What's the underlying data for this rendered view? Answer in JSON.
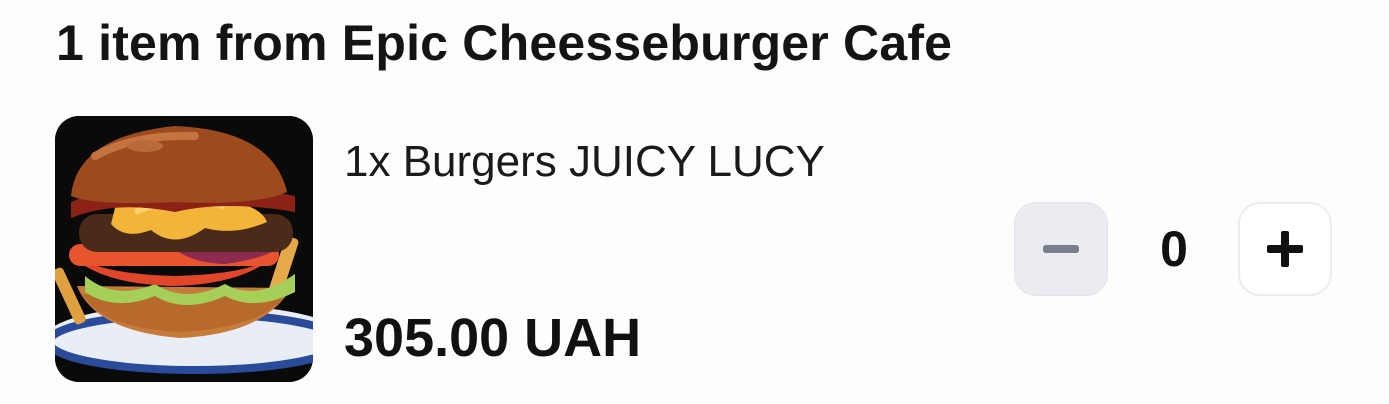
{
  "cart": {
    "heading": "1 item from Epic Cheesseburger Cafe"
  },
  "item": {
    "name": "1x Burgers JUICY LUCY",
    "price": "305.00 UAH",
    "image_icon": "burger-photo"
  },
  "stepper": {
    "quantity": "0",
    "minus_icon": "minus-icon",
    "plus_icon": "plus-icon"
  },
  "colors": {
    "minus_bg": "#ebecf2",
    "minus_glyph": "#7a7f8c",
    "plus_glyph": "#111111",
    "text": "#111111"
  }
}
